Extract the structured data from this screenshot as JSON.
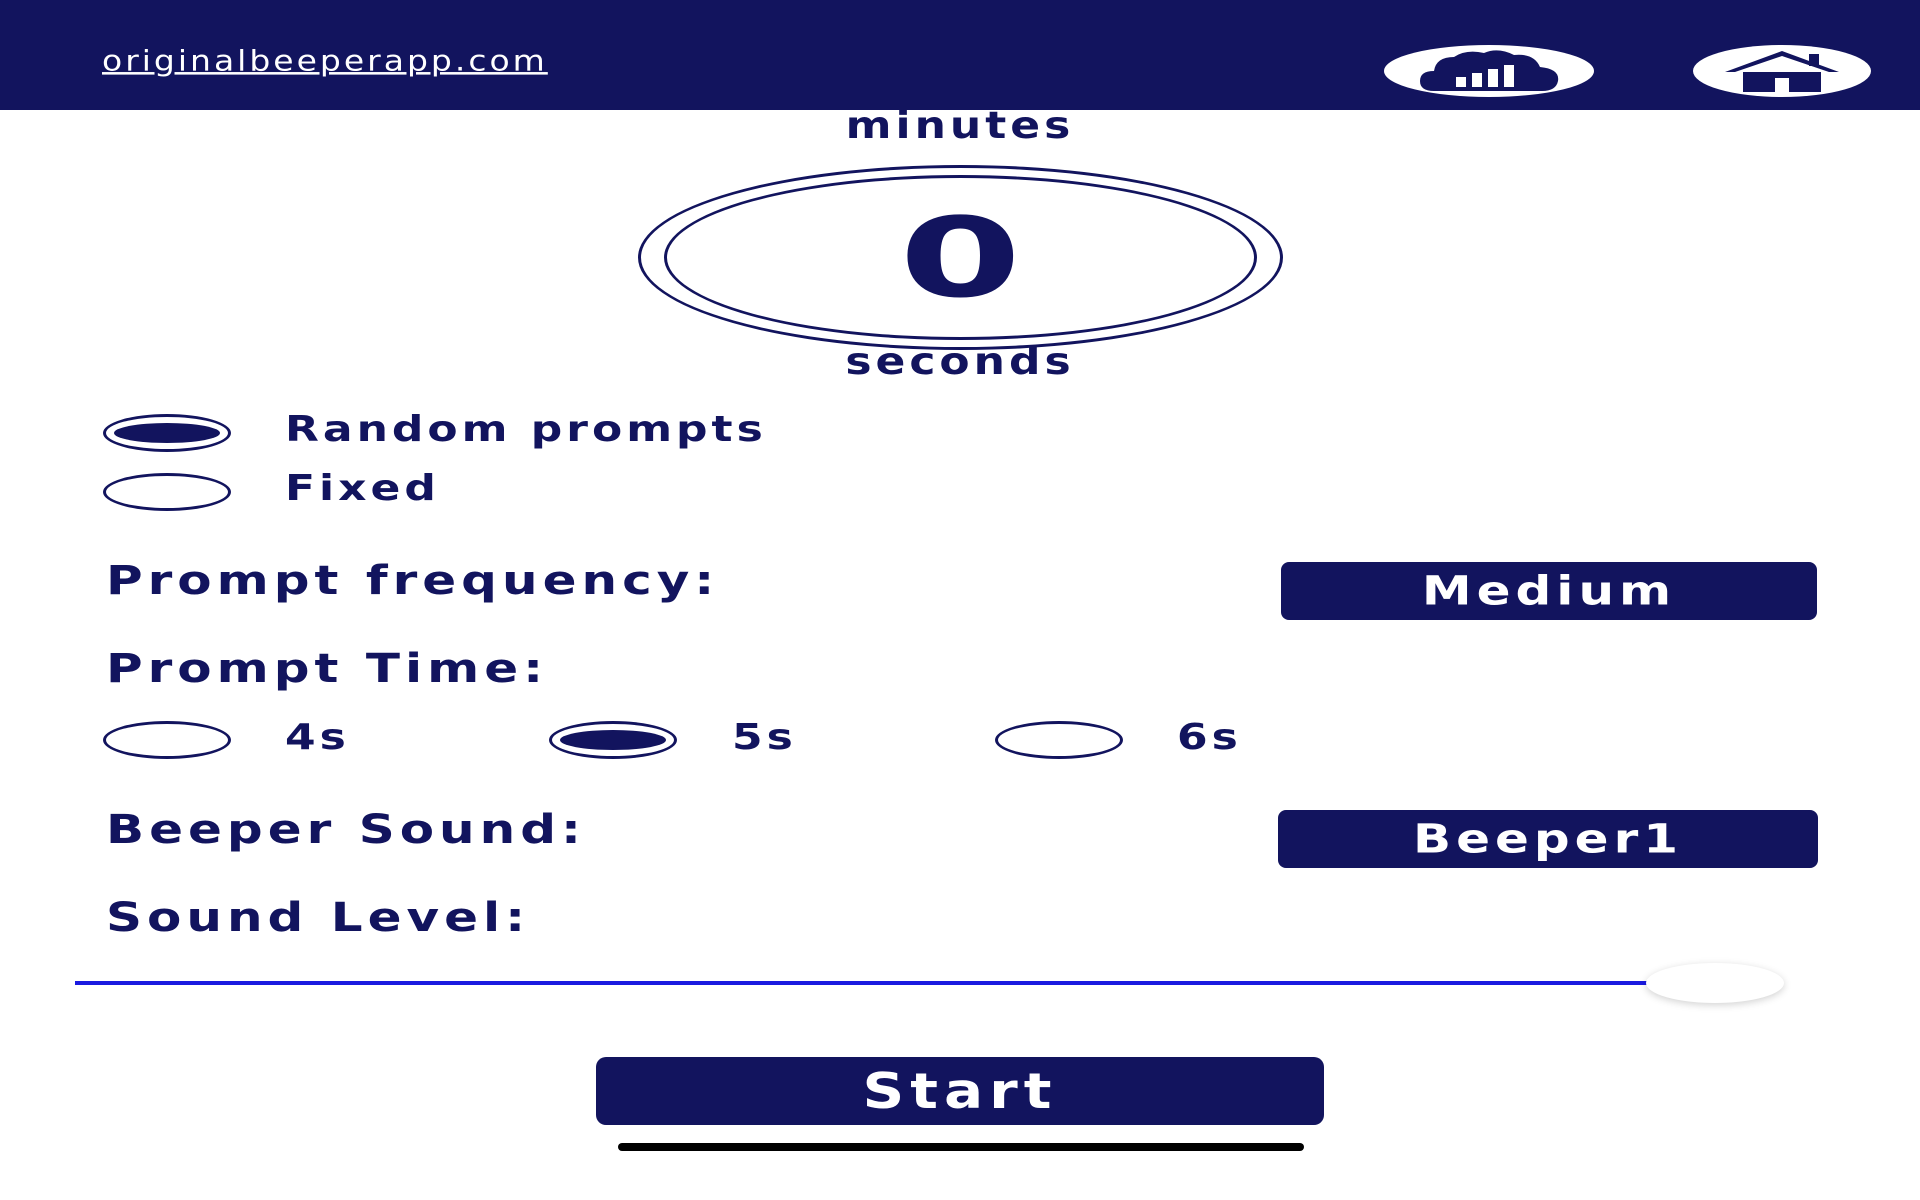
{
  "colors": {
    "primary": "#12145e",
    "slider_track": "#1a1ae0",
    "background": "#ffffff"
  },
  "header": {
    "site_link": "originalbeeperapp.com",
    "stats_icon": "cloud-bar-chart-icon",
    "home_icon": "home-icon"
  },
  "timer": {
    "minutes_label": "minutes",
    "value": "0",
    "seconds_label": "seconds"
  },
  "mode": {
    "options": [
      {
        "label": "Random prompts",
        "checked": true
      },
      {
        "label": "Fixed",
        "checked": false
      }
    ]
  },
  "frequency": {
    "label": "Prompt frequency:",
    "value": "Medium"
  },
  "prompt_time": {
    "label": "Prompt Time:",
    "options": [
      {
        "label": "4s",
        "checked": false
      },
      {
        "label": "5s",
        "checked": true
      },
      {
        "label": "6s",
        "checked": false
      }
    ]
  },
  "sound": {
    "label": "Beeper Sound:",
    "value": "Beeper1"
  },
  "level": {
    "label": "Sound Level:",
    "value_fraction": 1.0
  },
  "start_label": "Start"
}
